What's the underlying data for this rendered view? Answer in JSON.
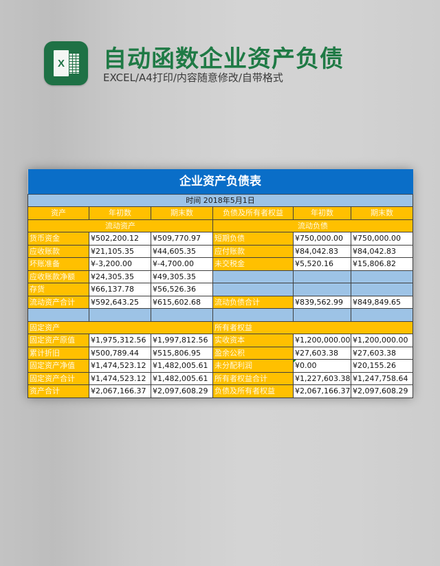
{
  "header": {
    "icon": "excel-icon",
    "icon_letter": "X",
    "title": "自动函数企业资产负债",
    "subtitle": "EXCEL/A4打印/内容随意修改/自带格式"
  },
  "colors": {
    "title_green": "#1f7a45",
    "excel_green": "#1e7145",
    "sheet_blue": "#0a6ec8",
    "light_blue": "#9dc3e6",
    "orange": "#ffc000"
  },
  "sheet": {
    "title": "企业资产负债表",
    "date": "时间 2018年5月1日",
    "columns": [
      "资产",
      "年初数",
      "期末数",
      "负债及所有者权益",
      "年初数",
      "期末数"
    ],
    "current_assets_header": "流动资产",
    "current_liabilities_header": "流动负债",
    "current_rows": [
      {
        "asset": "货币资金",
        "a_begin": "¥502,200.12",
        "a_end": "¥509,770.97",
        "liab": "短期负债",
        "l_begin": "¥750,000.00",
        "l_end": "¥750,000.00"
      },
      {
        "asset": "应收账款",
        "a_begin": "¥21,105.35",
        "a_end": "¥44,605.35",
        "liab": "应付账款",
        "l_begin": "¥84,042.83",
        "l_end": "¥84,042.83"
      },
      {
        "asset": "坏账准备",
        "a_begin": "¥-3,200.00",
        "a_end": "¥-4,700.00",
        "liab": "未交税金",
        "l_begin": "¥5,520.16",
        "l_end": "¥15,806.82"
      },
      {
        "asset": "应收账款净额",
        "a_begin": "¥24,305.35",
        "a_end": "¥49,305.35",
        "liab": "",
        "l_begin": "",
        "l_end": ""
      },
      {
        "asset": "存货",
        "a_begin": "¥66,137.78",
        "a_end": "¥56,526.36",
        "liab": "",
        "l_begin": "",
        "l_end": ""
      },
      {
        "asset": "流动资产合计",
        "a_begin": "¥592,643.25",
        "a_end": "¥615,602.68",
        "liab": "流动负债合计",
        "l_begin": "¥839,562.99",
        "l_end": "¥849,849.65"
      }
    ],
    "fixed_assets_header": "固定资产",
    "equity_header": "所有者权益",
    "fixed_rows": [
      {
        "asset": "固定资产原值",
        "a_begin": "¥1,975,312.56",
        "a_end": "¥1,997,812.56",
        "liab": "实收资本",
        "l_begin": "¥1,200,000.00",
        "l_end": "¥1,200,000.00"
      },
      {
        "asset": "累计折旧",
        "a_begin": "¥500,789.44",
        "a_end": "¥515,806.95",
        "liab": "盈余公积",
        "l_begin": "¥27,603.38",
        "l_end": "¥27,603.38"
      },
      {
        "asset": "固定资产净值",
        "a_begin": "¥1,474,523.12",
        "a_end": "¥1,482,005.61",
        "liab": "未分配利润",
        "l_begin": "¥0.00",
        "l_end": "¥20,155.26"
      },
      {
        "asset": "固定资产合计",
        "a_begin": "¥1,474,523.12",
        "a_end": "¥1,482,005.61",
        "liab": "所有者权益合计",
        "l_begin": "¥1,227,603.38",
        "l_end": "¥1,247,758.64"
      },
      {
        "asset": "资产合计",
        "a_begin": "¥2,067,166.37",
        "a_end": "¥2,097,608.29",
        "liab": "负债及所有者权益",
        "l_begin": "¥2,067,166.37",
        "l_end": "¥2,097,608.29"
      }
    ]
  }
}
